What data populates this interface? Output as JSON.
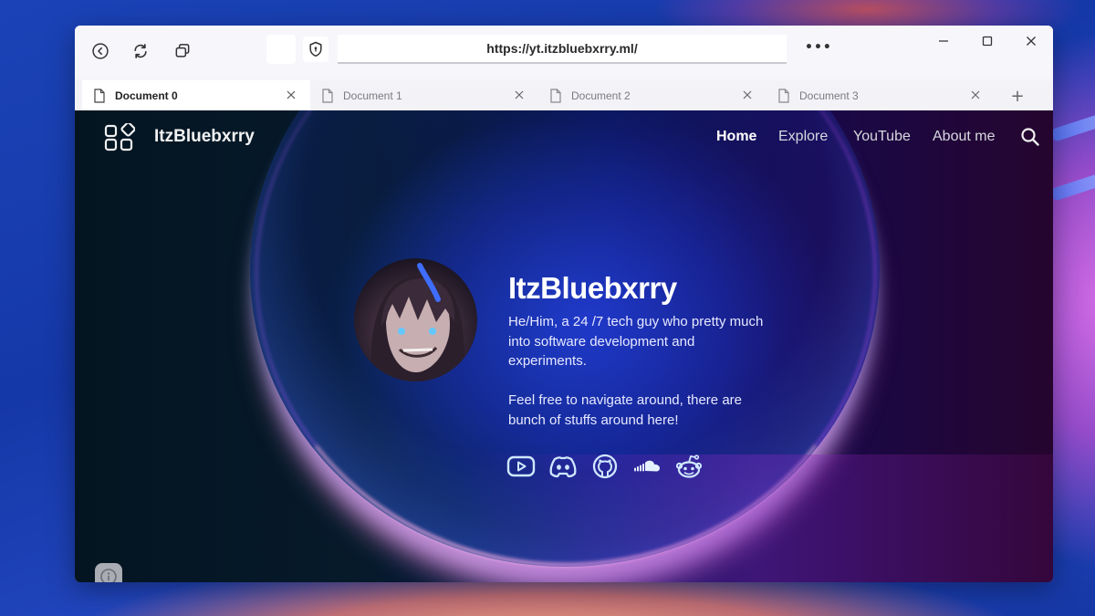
{
  "browser": {
    "url": "https://yt.itzbluebxrry.ml/",
    "more_label": "•••",
    "toolbar_icons": [
      "back-icon",
      "refresh-icon",
      "tab-overview-icon",
      "shield-icon"
    ],
    "window_controls": [
      "minimize-icon",
      "maximize-icon",
      "close-icon"
    ],
    "tabs": [
      {
        "label": "Document 0",
        "active": true
      },
      {
        "label": "Document 1",
        "active": false
      },
      {
        "label": "Document 2",
        "active": false
      },
      {
        "label": "Document 3",
        "active": false
      }
    ],
    "new_tab_label": "+"
  },
  "site": {
    "brand": "ItzBluebxrry",
    "brand_icon": "apps-grid-icon",
    "nav": [
      {
        "label": "Home",
        "active": true
      },
      {
        "label": "Explore",
        "active": false
      },
      {
        "label": "YouTube",
        "active": false
      },
      {
        "label": "About me",
        "active": false
      }
    ],
    "search_icon": "search-icon",
    "hero": {
      "title": "ItzBluebxrry",
      "bio": "He/Him, a 24 /7 tech guy who pretty much into software development and experiments.",
      "invite": "Feel free to navigate around, there are bunch of stuffs around here!",
      "avatar": "profile-avatar"
    },
    "socials": [
      {
        "name": "YouTube",
        "icon": "youtube-icon"
      },
      {
        "name": "Discord",
        "icon": "discord-icon"
      },
      {
        "name": "GitHub",
        "icon": "github-icon"
      },
      {
        "name": "SoundCloud",
        "icon": "soundcloud-icon"
      },
      {
        "name": "Reddit",
        "icon": "reddit-icon"
      }
    ],
    "info_icon": "info-icon"
  },
  "colors": {
    "accent_text": "#ffffff",
    "nav_text": "#d8d8e0",
    "icon_outline": "#cfe8ff"
  }
}
